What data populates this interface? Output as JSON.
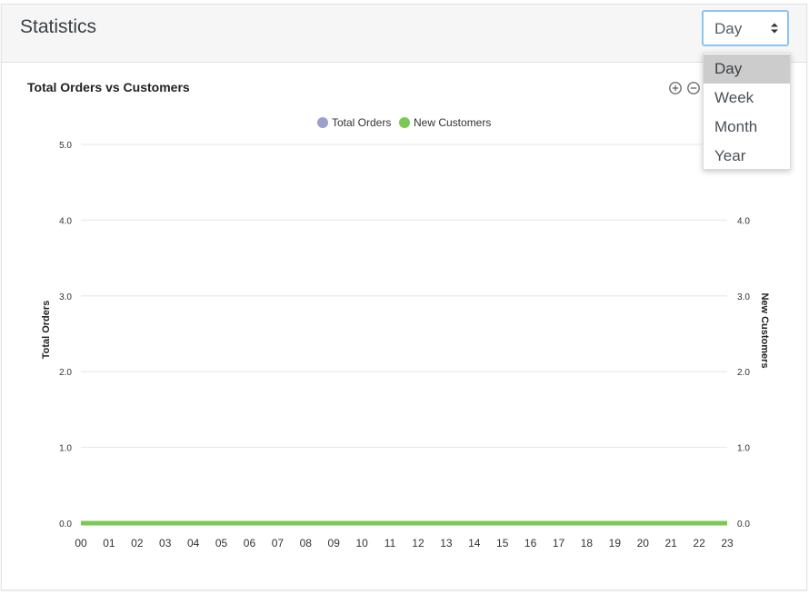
{
  "header": {
    "title": "Statistics"
  },
  "period_select": {
    "value": "Day",
    "options": [
      "Day",
      "Week",
      "Month",
      "Year"
    ],
    "selected_index": 0
  },
  "toolbar": {
    "zoom_in_icon": "zoom-in-icon",
    "zoom_out_icon": "zoom-out-icon"
  },
  "colors": {
    "total_orders": "#9ba0cc",
    "new_customers": "#7cc855",
    "grid": "#e6e6e6",
    "select_border": "#8cc4f2"
  },
  "chart_data": {
    "type": "line",
    "title": "Total Orders vs Customers",
    "legend_position": "top-center",
    "grid": true,
    "categories": [
      "00",
      "01",
      "02",
      "03",
      "04",
      "05",
      "06",
      "07",
      "08",
      "09",
      "10",
      "11",
      "12",
      "13",
      "14",
      "15",
      "16",
      "17",
      "18",
      "19",
      "20",
      "21",
      "22",
      "23"
    ],
    "series": [
      {
        "name": "Total Orders",
        "axis": "left",
        "values": [
          0,
          0,
          0,
          0,
          0,
          0,
          0,
          0,
          0,
          0,
          0,
          0,
          0,
          0,
          0,
          0,
          0,
          0,
          0,
          0,
          0,
          0,
          0,
          0
        ]
      },
      {
        "name": "New Customers",
        "axis": "right",
        "values": [
          0,
          0,
          0,
          0,
          0,
          0,
          0,
          0,
          0,
          0,
          0,
          0,
          0,
          0,
          0,
          0,
          0,
          0,
          0,
          0,
          0,
          0,
          0,
          0
        ]
      }
    ],
    "y_left": {
      "label": "Total Orders",
      "range": [
        0,
        5
      ],
      "ticks": [
        "0.0",
        "1.0",
        "2.0",
        "3.0",
        "4.0",
        "5.0"
      ]
    },
    "y_right": {
      "label": "New Customers",
      "range": [
        0,
        5
      ],
      "ticks": [
        "0.0",
        "1.0",
        "2.0",
        "3.0",
        "4.0"
      ]
    }
  }
}
